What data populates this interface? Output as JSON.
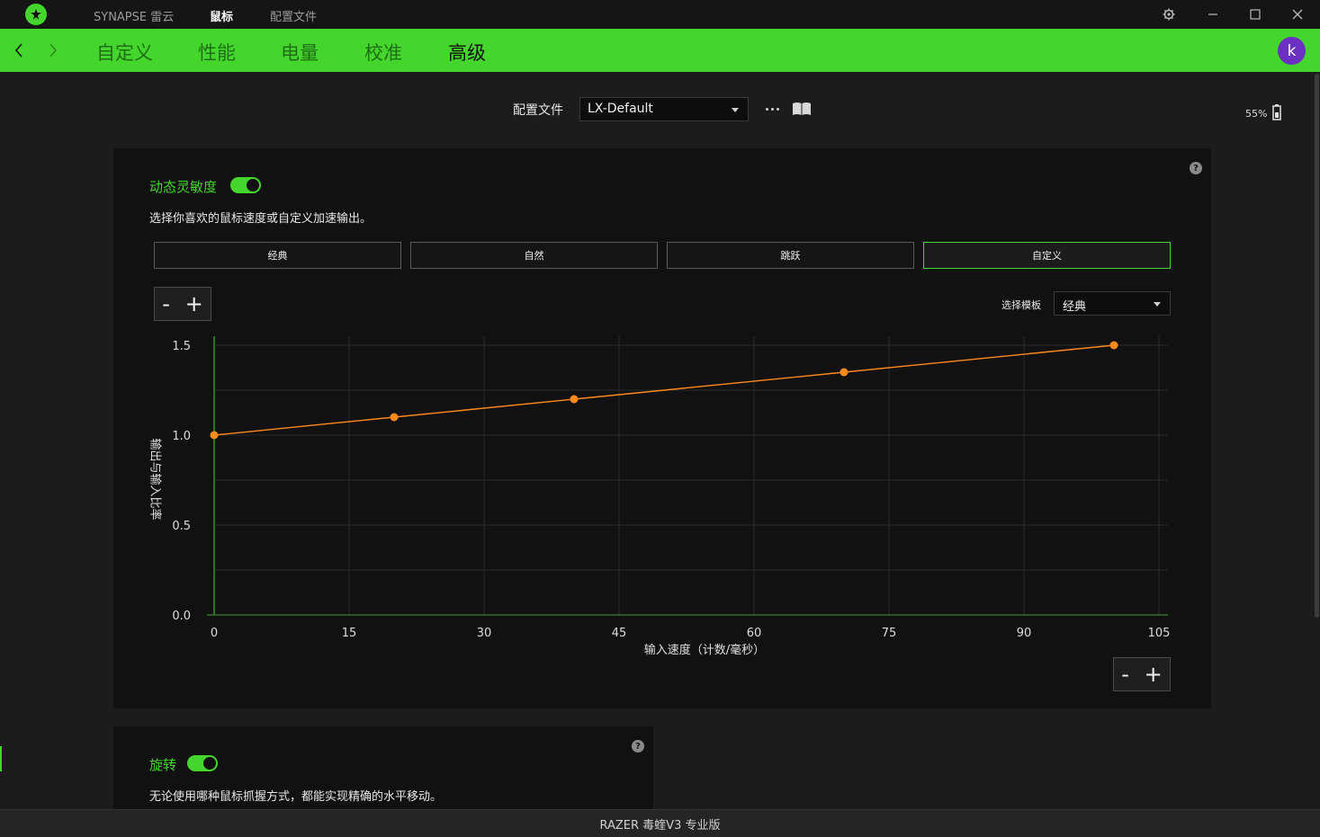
{
  "titlebar": {
    "app_name": "SYNAPSE 雷云",
    "tab_mouse": "鼠标",
    "tab_profile": "配置文件"
  },
  "nav": {
    "tabs": [
      "自定义",
      "性能",
      "电量",
      "校准",
      "高级"
    ],
    "active_tab": "高级",
    "avatar_letter": "k"
  },
  "profile": {
    "label": "配置文件",
    "selected": "LX-Default"
  },
  "battery": {
    "percent": 0.55,
    "text": "55%"
  },
  "dynamic_sensitivity": {
    "title": "动态灵敏度",
    "enabled": true,
    "description": "选择你喜欢的鼠标速度或自定义加速输出。",
    "modes": [
      "经典",
      "自然",
      "跳跃",
      "自定义"
    ],
    "selected_mode": "自定义",
    "zoom_minus": "-",
    "zoom_plus": "+",
    "template_label": "选择模板",
    "template_selected": "经典"
  },
  "chart_data": {
    "type": "line",
    "xlabel": "输入速度（计数/毫秒）",
    "ylabel": "输出与输入比率",
    "x_ticks": [
      "0",
      "15",
      "30",
      "45",
      "60",
      "75",
      "90",
      "105"
    ],
    "y_ticks": [
      "0.0",
      "0.5",
      "1.0",
      "1.5"
    ],
    "xlim": [
      0,
      105
    ],
    "ylim": [
      0,
      1.5
    ],
    "grid": true,
    "series": [
      {
        "color": "#ff8a1c",
        "x": [
          0,
          20,
          40,
          70,
          100
        ],
        "y": [
          1.0,
          1.1,
          1.2,
          1.35,
          1.5
        ]
      }
    ]
  },
  "rotation": {
    "title": "旋转",
    "enabled": true,
    "description": "无论使用哪种鼠标抓握方式，都能实现精确的水平移动。"
  },
  "statusbar": {
    "device": "RAZER 毒蝰V3 专业版"
  },
  "colors": {
    "accent": "#44d62c",
    "curve": "#ff8a1c"
  }
}
